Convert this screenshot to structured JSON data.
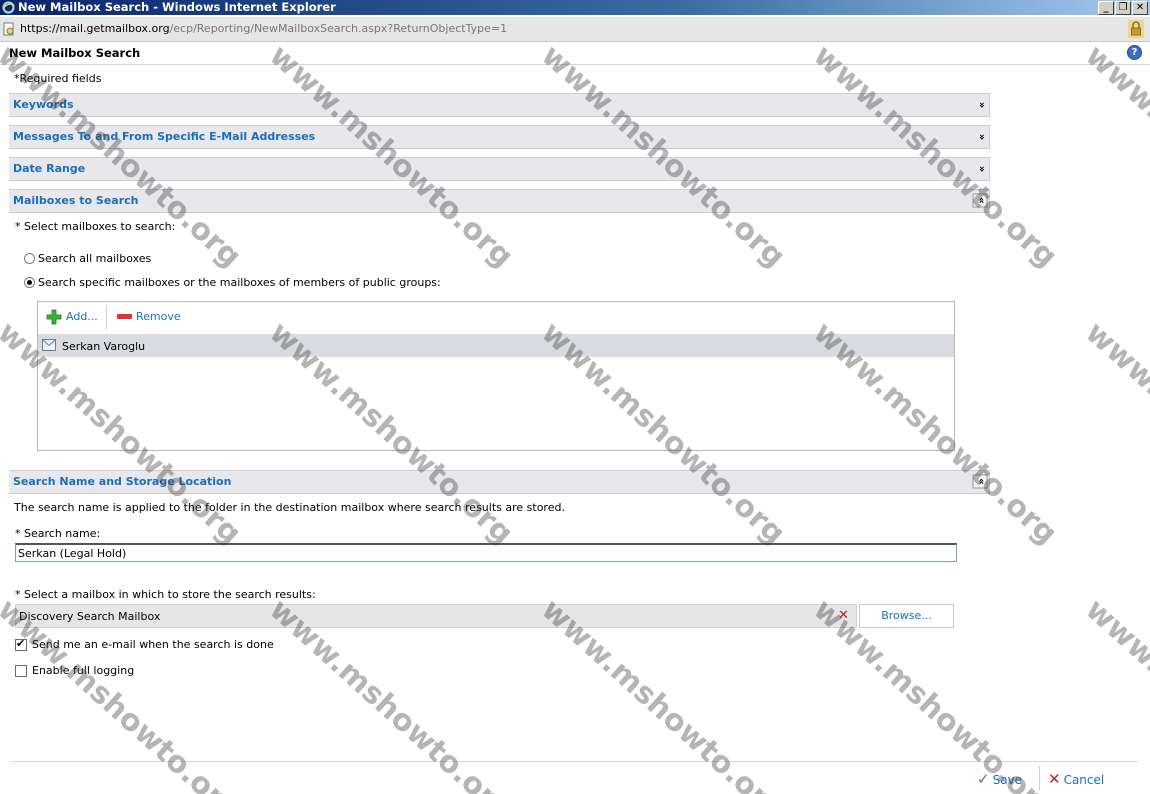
{
  "window": {
    "title": "New Mailbox Search - Windows Internet Explorer",
    "minimize": "_",
    "restore": "❐",
    "close": "✕"
  },
  "address": {
    "scheme": "https://",
    "host": "mail.getmailbox.org",
    "path": "/ecp/Reporting/NewMailboxSearch.aspx?ReturnObjectType=1"
  },
  "page": {
    "title": "New Mailbox Search",
    "help": "?",
    "required_note": "*Required fields"
  },
  "sections": {
    "keywords": "Keywords",
    "messages": "Messages To and From Specific E-Mail Addresses",
    "date_range": "Date Range",
    "mailboxes": "Mailboxes to Search",
    "search_name_storage": "Search Name and Storage Location"
  },
  "mailboxes": {
    "select_label": "* Select mailboxes to search:",
    "option_all": "Search all mailboxes",
    "option_specific": "Search specific mailboxes or the mailboxes of members of public groups:",
    "add_label": "Add...",
    "remove_label": "Remove",
    "items": [
      "Serkan Varoglu"
    ]
  },
  "storage": {
    "description": "The search name is applied to the folder in the destination mailbox where search results are stored.",
    "search_name_label": "* Search name:",
    "search_name_value": "Serkan (Legal Hold)",
    "select_mailbox_label": "* Select a mailbox in which to store the search results:",
    "mailbox_value": "Discovery Search Mailbox",
    "browse_label": "Browse...",
    "send_email_label": "Send me an e-mail when the search is done",
    "full_logging_label": "Enable full logging"
  },
  "footer": {
    "save_label": "Save",
    "cancel_label": "Cancel"
  },
  "watermark": "www.mshowto.org",
  "colors": {
    "link": "#1a6fb8",
    "section_bg": "#e8e8ec",
    "selected_row": "#d9dbe0"
  }
}
